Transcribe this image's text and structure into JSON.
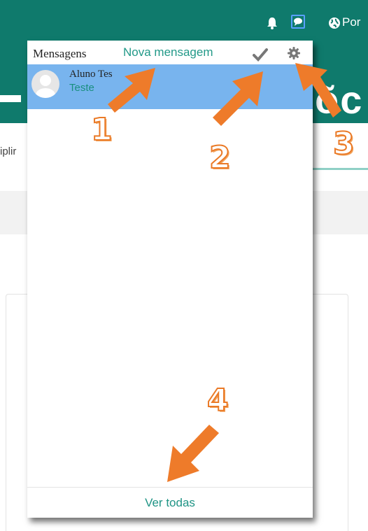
{
  "navbar": {
    "language_label": "Por",
    "icons": [
      "bell-icon",
      "chat-icon",
      "globe-icon"
    ]
  },
  "background": {
    "subnav_text": "iplir"
  },
  "popover": {
    "title": "Mensagens",
    "new_message_link": "Nova mensagem",
    "mark_read_icon": "check-icon",
    "settings_icon": "gear-icon",
    "messages": [
      {
        "sender": "Aluno Tes",
        "preview": "Teste"
      }
    ],
    "view_all_link": "Ver todas"
  },
  "annotations": {
    "labels": [
      "1",
      "2",
      "3",
      "4"
    ],
    "colors": {
      "arrow": "#ee7b2a",
      "label_outline": "#ea7a27"
    }
  },
  "colors": {
    "navbar": "#0f7a6c",
    "selected_message": "#78b4ee",
    "link": "#229988"
  }
}
